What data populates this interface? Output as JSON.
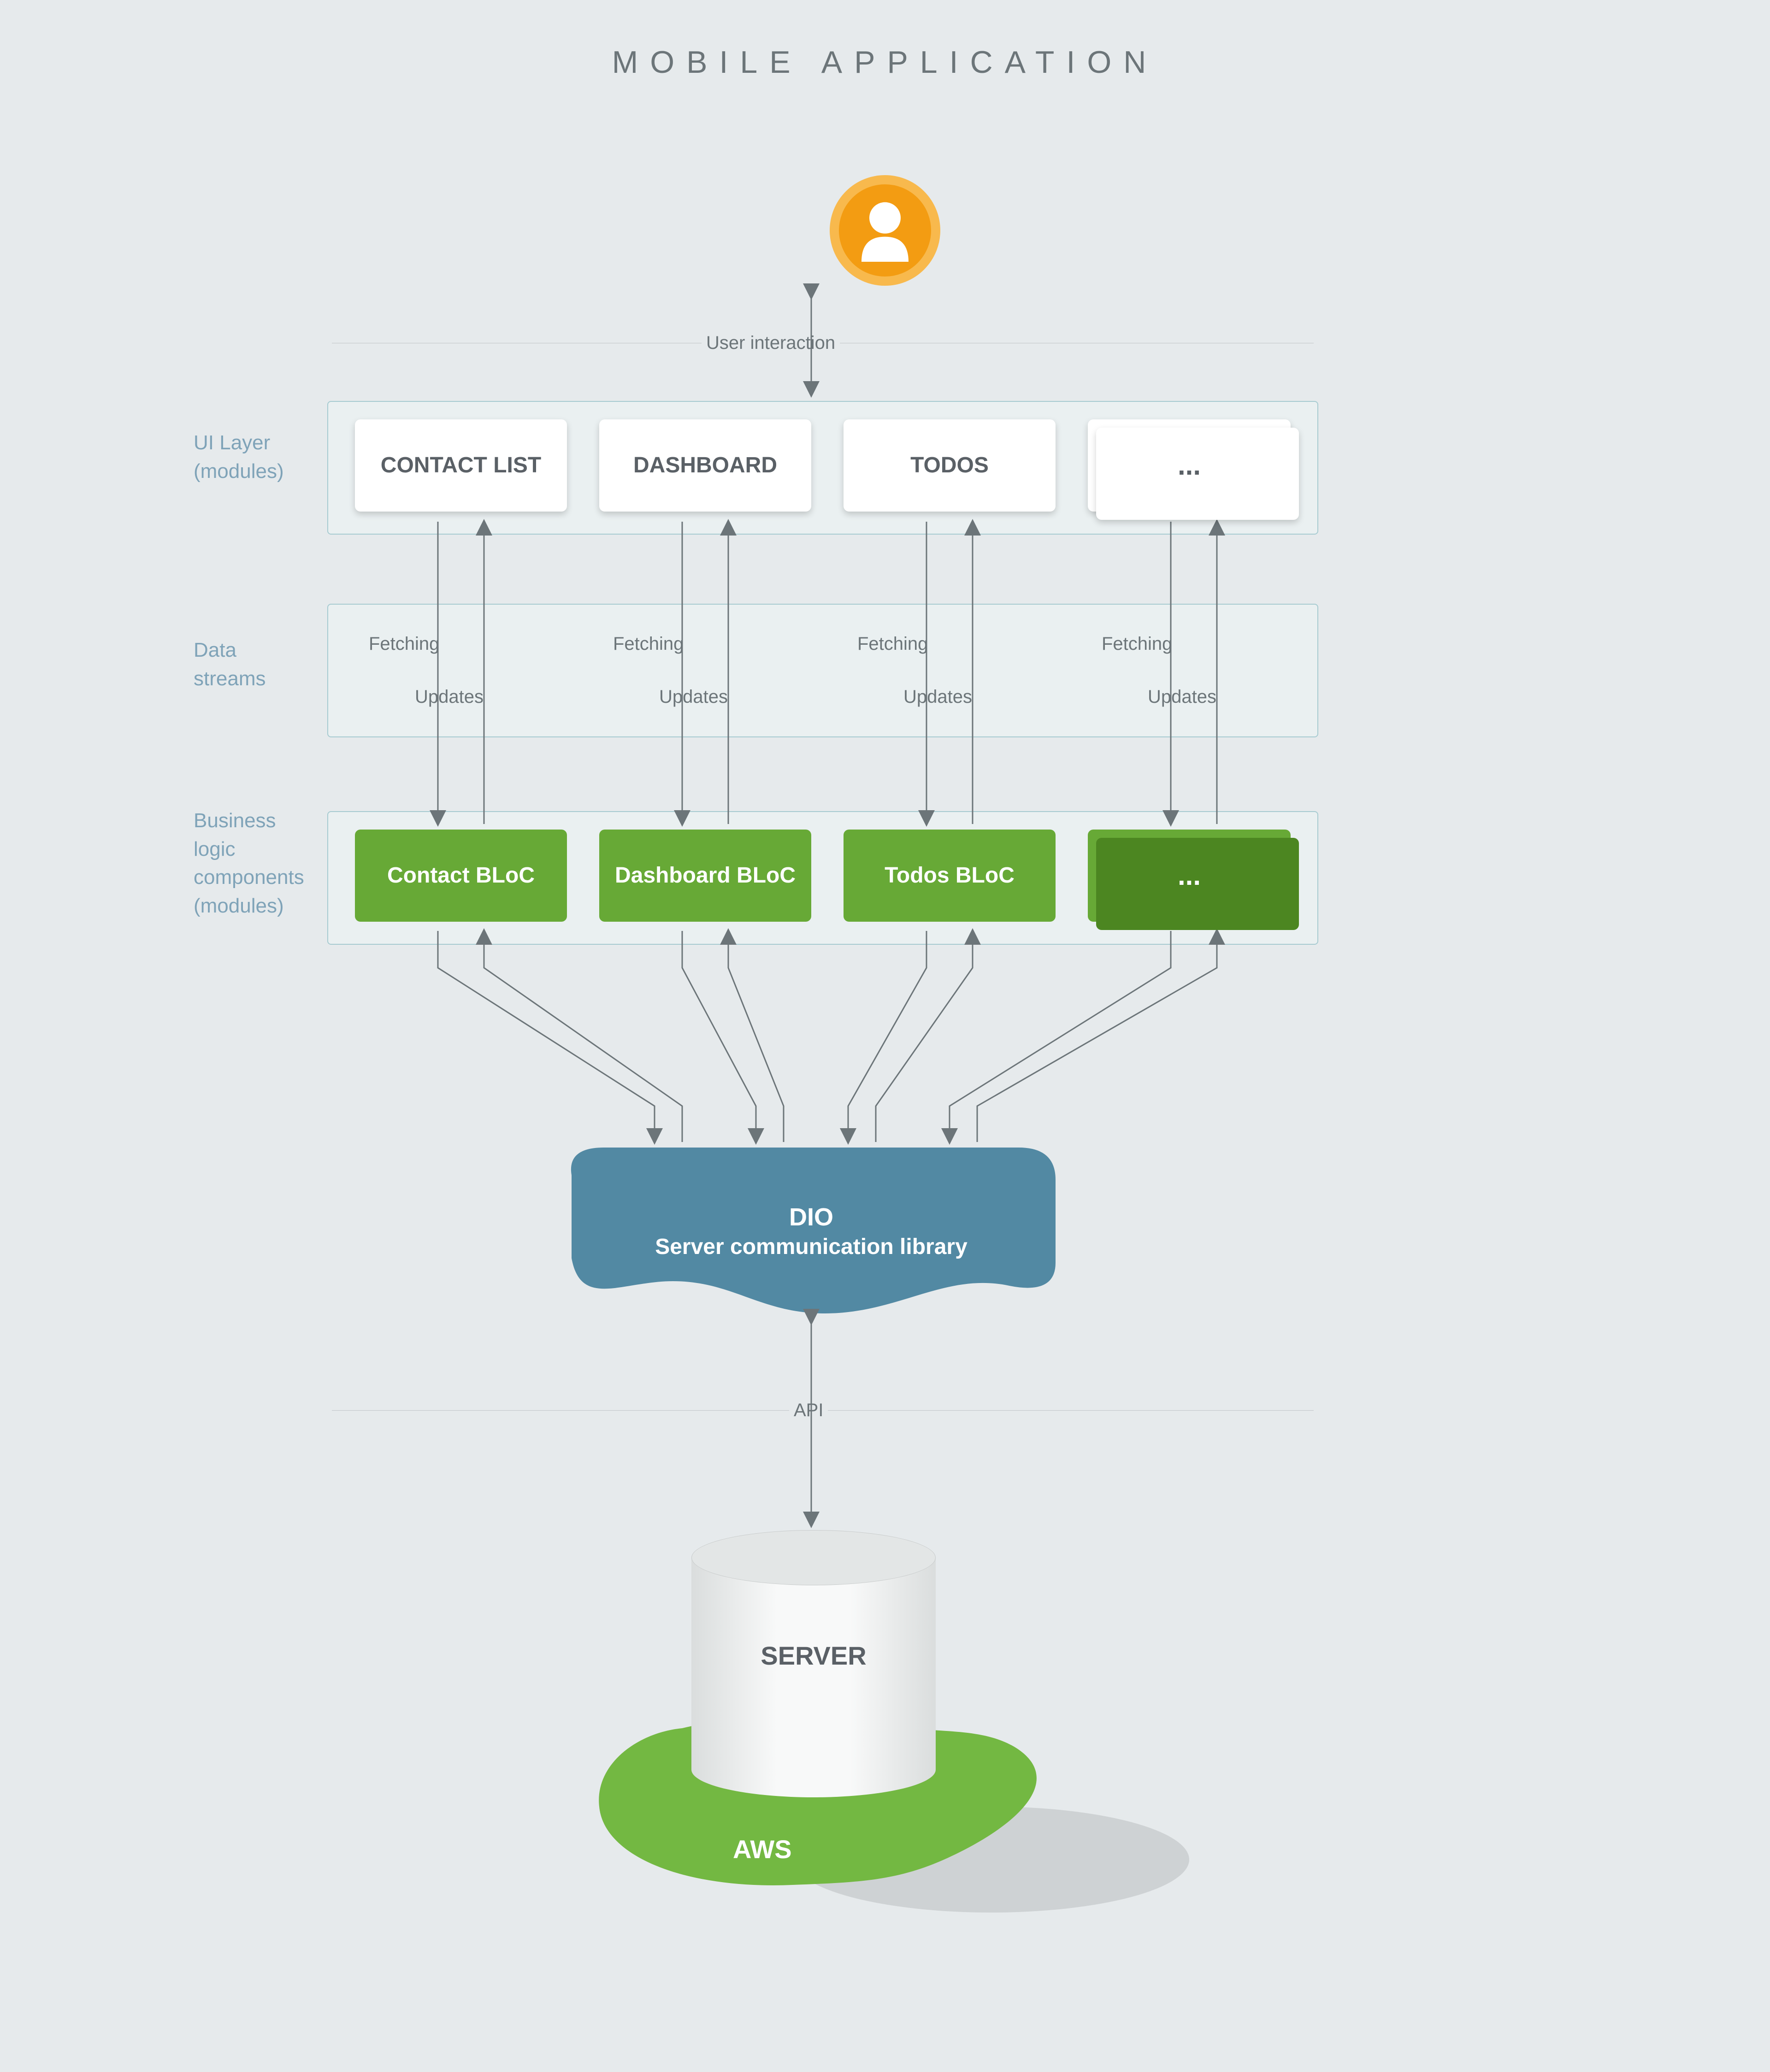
{
  "title": "MOBILE APPLICATION",
  "edge_user_interaction": "User interaction",
  "edge_api": "API",
  "side": {
    "ui_layer": "UI Layer\n(modules)",
    "data_streams": "Data\nstreams",
    "bloc": "Business\nlogic\ncomponents\n(modules)"
  },
  "ui_cards": {
    "c0": "CONTACT LIST",
    "c1": "DASHBOARD",
    "c2": "TODOS",
    "c3": "..."
  },
  "bloc_cards": {
    "b0": "Contact BLoC",
    "b1": "Dashboard BLoC",
    "b2": "Todos BLoC",
    "b3": "..."
  },
  "stream_labels": {
    "fetching": "Fetching",
    "updates": "Updates"
  },
  "dio": {
    "line1": "DIO",
    "line2": "Server communication library"
  },
  "server_label": "SERVER",
  "aws_label": "AWS",
  "colors": {
    "accent_orange": "#f39c12",
    "accent_green": "#67a936",
    "accent_blue": "#5289a3",
    "aws_green": "#73b842"
  }
}
